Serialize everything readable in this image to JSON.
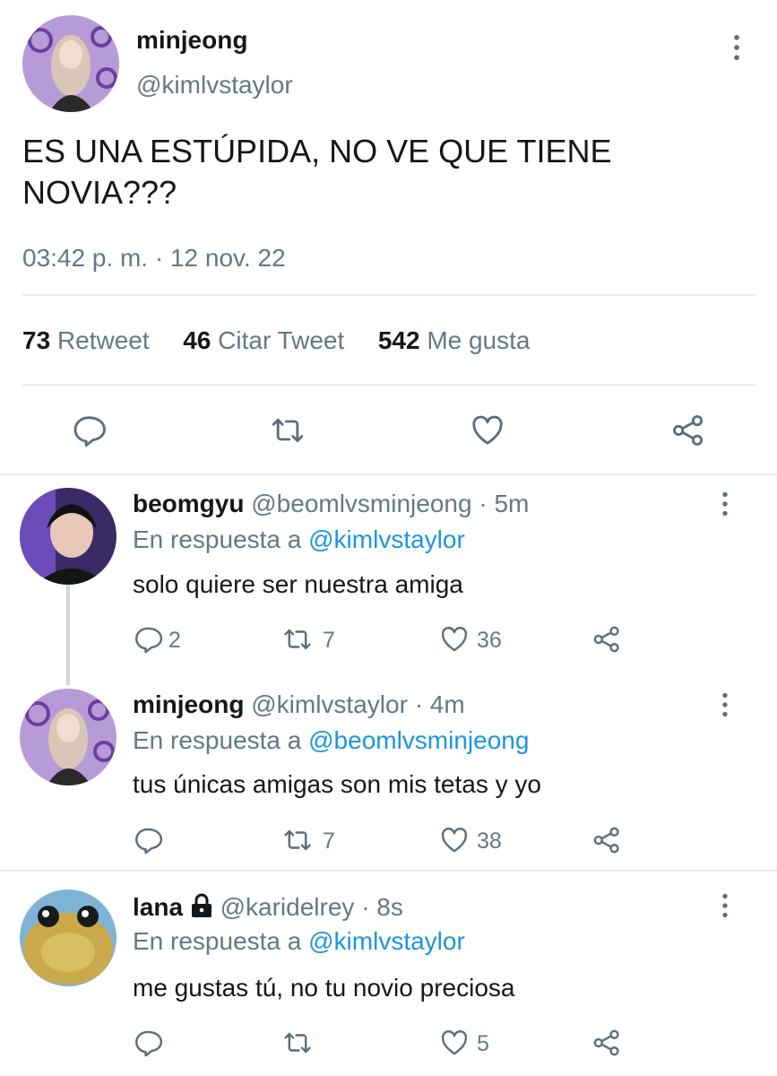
{
  "main_tweet": {
    "display_name": "minjeong",
    "handle": "@kimlvstaylor",
    "text_line1": "ES UNA ESTÚPIDA, NO VE QUE TIENE",
    "text_line2": "NOVIA???",
    "timestamp": "03:42 p. m. · 12 nov. 22",
    "stats": {
      "retweets_count": "73",
      "retweets_label": "Retweet",
      "quotes_count": "46",
      "quotes_label": "Citar Tweet",
      "likes_count": "542",
      "likes_label": "Me gusta"
    }
  },
  "replies": [
    {
      "display_name": "beomgyu",
      "handle": "@beomlvsminjeong",
      "time": "· 5m",
      "reply_to_prefix": "En respuesta a",
      "reply_to_handle": "@kimlvstaylor",
      "text": "solo quiere ser nuestra amiga",
      "replies_count": "2",
      "retweets_count": "7",
      "likes_count": "36"
    },
    {
      "display_name": "minjeong",
      "handle": "@kimlvstaylor",
      "time": "· 4m",
      "reply_to_prefix": "En respuesta a",
      "reply_to_handle": "@beomlvsminjeong",
      "text": "tus únicas amigas son mis tetas y yo",
      "replies_count": "",
      "retweets_count": "7",
      "likes_count": "38"
    },
    {
      "display_name": "lana",
      "handle": "@karidelrey",
      "time": "· 8s",
      "reply_to_prefix": "En respuesta a",
      "reply_to_handle": "@kimlvstaylor",
      "text": "me gustas tú, no tu novio preciosa",
      "replies_count": "",
      "retweets_count": "",
      "likes_count": "5"
    }
  ],
  "icons": {
    "more": "more-vertical-icon",
    "reply": "reply-icon",
    "retweet": "retweet-icon",
    "like": "heart-icon",
    "share": "share-icon",
    "lock": "lock-icon"
  },
  "colors": {
    "text": "#14171a",
    "secondary": "#657786",
    "link": "#1b95e0",
    "divider": "#e6ecf0"
  }
}
